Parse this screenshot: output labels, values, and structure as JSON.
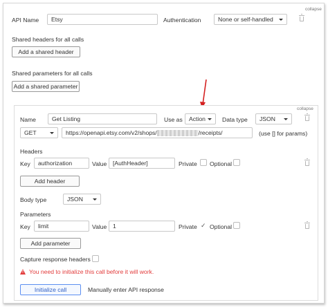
{
  "top": {
    "api_name_label": "API Name",
    "api_name_value": "Etsy",
    "auth_label": "Authentication",
    "auth_value": "None or self-handled",
    "collapse_label": "collapse",
    "shared_headers_label": "Shared headers for all calls",
    "add_shared_header_button": "Add a shared header",
    "shared_params_label": "Shared parameters for all calls",
    "add_shared_param_button": "Add a shared parameter"
  },
  "call": {
    "collapse_label": "collapse",
    "name_label": "Name",
    "name_value": "Get Listing",
    "use_as_label": "Use as",
    "use_as_value": "Action",
    "data_type_label": "Data type",
    "data_type_value": "JSON",
    "method_value": "GET",
    "url_prefix": "https://openapi.etsy.com/v2/shops/",
    "url_suffix": "/receipts/",
    "url_hint": "(use [] for params)",
    "headers_label": "Headers",
    "header_row": {
      "key_label": "Key",
      "key_value": "authorization",
      "value_label": "Value",
      "value_value": "[AuthHeader]",
      "private_label": "Private",
      "optional_label": "Optional"
    },
    "add_header_button": "Add header",
    "body_type_label": "Body type",
    "body_type_value": "JSON",
    "parameters_label": "Parameters",
    "param_row": {
      "key_label": "Key",
      "key_value": "limit",
      "value_label": "Value",
      "value_value": "1",
      "private_label": "Private",
      "private_checked_mark": "✓",
      "optional_label": "Optional"
    },
    "add_parameter_button": "Add parameter",
    "capture_label": "Capture response headers",
    "warning_icon_glyph": "!",
    "warning_text": "You need to initialize this call before it will work.",
    "initialize_button": "Initialize call",
    "manual_link": "Manually enter API response"
  },
  "colors": {
    "warning": "#e23b3b",
    "annotation_arrow": "#d42020",
    "primary_border": "#5b8ef1"
  }
}
